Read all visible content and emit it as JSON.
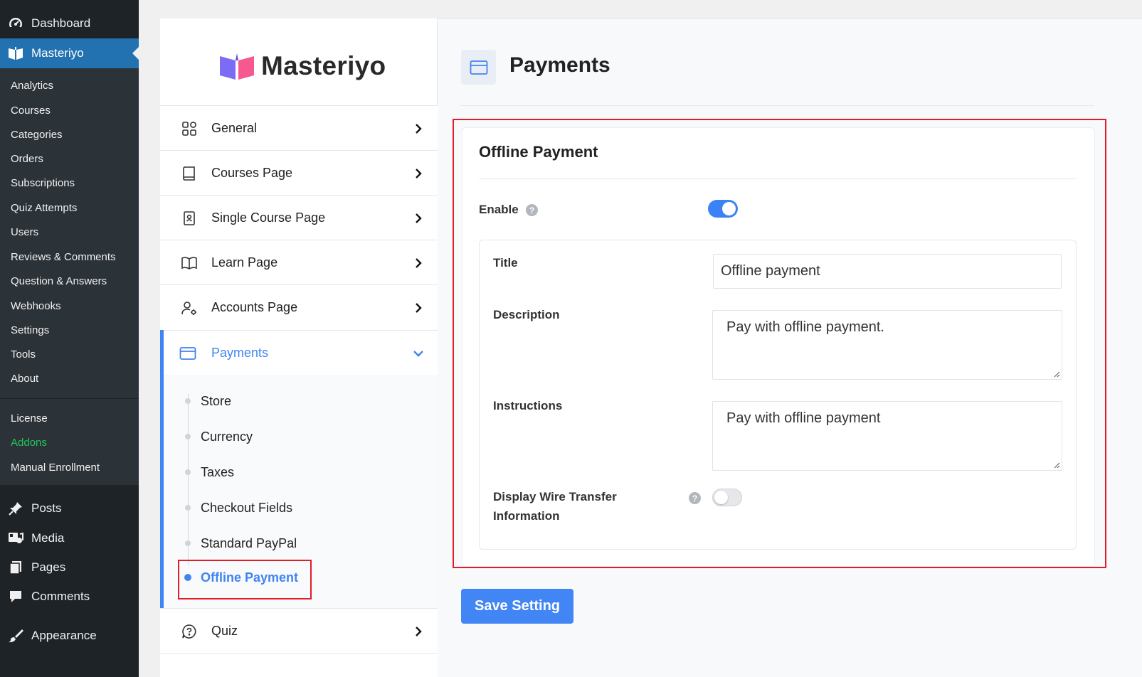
{
  "wp_menu": {
    "dashboard": "Dashboard",
    "masteriyo": "Masteriyo",
    "sub_items": [
      "Analytics",
      "Courses",
      "Categories",
      "Orders",
      "Subscriptions",
      "Quiz Attempts",
      "Users",
      "Reviews & Comments",
      "Question & Answers",
      "Webhooks",
      "Settings",
      "Tools",
      "About"
    ],
    "extra_items": [
      "License",
      "Addons",
      "Manual Enrollment"
    ],
    "bottom_items": [
      "Posts",
      "Media",
      "Pages",
      "Comments",
      "Appearance"
    ]
  },
  "logo": {
    "text": "Masteriyo"
  },
  "settings_nav": {
    "items": [
      {
        "label": "General",
        "icon": "grid-icon"
      },
      {
        "label": "Courses Page",
        "icon": "book-icon"
      },
      {
        "label": "Single Course Page",
        "icon": "contact-book-icon"
      },
      {
        "label": "Learn Page",
        "icon": "open-book-icon"
      },
      {
        "label": "Accounts Page",
        "icon": "user-gear-icon"
      }
    ],
    "payments": {
      "label": "Payments",
      "sub_items": [
        "Store",
        "Currency",
        "Taxes",
        "Checkout Fields",
        "Standard PayPal",
        "Offline Payment"
      ],
      "active_sub": "Offline Payment"
    },
    "quiz": {
      "label": "Quiz"
    }
  },
  "page": {
    "title": "Payments"
  },
  "offline_payment": {
    "heading": "Offline Payment",
    "enable_label": "Enable",
    "enabled": true,
    "title_label": "Title",
    "title_value": "Offline payment",
    "description_label": "Description",
    "description_value": "Pay with offline payment.",
    "instructions_label": "Instructions",
    "instructions_value": "Pay with offline payment",
    "wire_label_line1": "Display Wire Transfer",
    "wire_label_line2": "Information",
    "wire_enabled": false,
    "help_glyph": "?"
  },
  "save_label": "Save Setting",
  "colors": {
    "accent": "#4285f4",
    "highlight": "#e11d2a",
    "wp_active": "#2271b1",
    "addons": "#22c55e"
  }
}
